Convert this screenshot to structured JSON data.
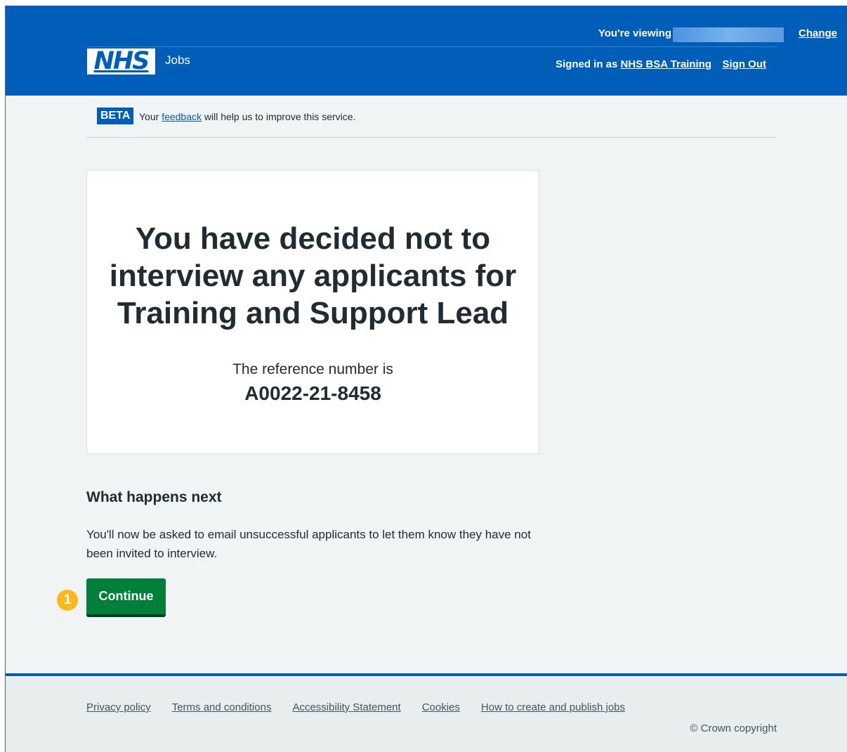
{
  "header": {
    "viewing_label": "You're viewing",
    "change_label": "Change",
    "logo_text": "NHS",
    "service_name": "Jobs",
    "signed_in_prefix": "Signed in as",
    "signed_in_user": "NHS BSA Training",
    "sign_out_label": "Sign Out"
  },
  "beta": {
    "tag": "BETA",
    "prefix": "Your",
    "link": "feedback",
    "suffix": "will help us to improve this service."
  },
  "panel": {
    "title": "You have decided not to interview any applicants for Training and Support Lead",
    "reference_label": "The reference number is",
    "reference_number": "A0022-21-8458"
  },
  "next": {
    "heading": "What happens next",
    "body": "You'll now be asked to email unsuccessful applicants to let them know they have not been invited to interview."
  },
  "actions": {
    "step_badge": "1",
    "continue_label": "Continue"
  },
  "footer": {
    "links": [
      "Privacy policy",
      "Terms and conditions",
      "Accessibility Statement",
      "Cookies",
      "How to create and publish jobs"
    ],
    "copyright": "© Crown copyright"
  },
  "colors": {
    "nhs_blue": "#005eb8",
    "button_green": "#007f3b",
    "badge_yellow": "#ffb81c",
    "background": "#f0f4f5"
  }
}
